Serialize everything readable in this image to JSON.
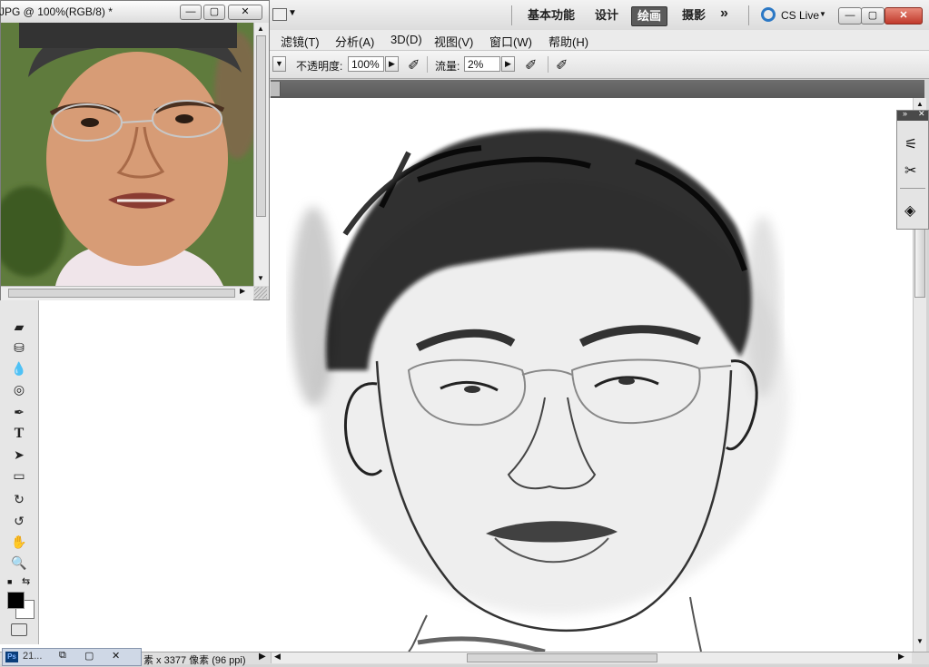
{
  "app": {
    "workspaces": [
      "基本功能",
      "设计",
      "绘画",
      "摄影"
    ],
    "active_workspace": "绘画",
    "more_label": "»",
    "cs_live": "CS Live",
    "win_min": "—",
    "win_max": "▢",
    "win_close": "✕"
  },
  "menus": [
    "滤镜(T)",
    "分析(A)",
    "3D(D)",
    "视图(V)",
    "窗口(W)",
    "帮助(H)"
  ],
  "options": {
    "opacity_label": "不透明度:",
    "opacity_value": "100%",
    "flow_label": "流量:",
    "flow_value": "2%"
  },
  "photo_window": {
    "title": "JPG @ 100%(RGB/8) *",
    "min": "—",
    "max": "▢",
    "close": "✕"
  },
  "status": {
    "doc_info": "素 x 3377 像素 (96 ppi)",
    "taskbar_item": "21..."
  },
  "tools": [
    "eraser-icon",
    "paint-bucket-icon",
    "blur-drop-icon",
    "sponge-icon",
    "pen-icon",
    "type-icon",
    "path-select-icon",
    "rectangle-shape-icon",
    "3d-rotate-icon",
    "3d-orbit-icon",
    "hand-icon",
    "zoom-icon"
  ],
  "tool_glyphs": [
    "▰",
    "⛁",
    "💧",
    "◎",
    "✒",
    "T",
    "➤",
    "▭",
    "↻",
    "↺",
    "✋",
    "🔍"
  ],
  "colors": {
    "foreground": "#000000",
    "background": "#ffffff",
    "accent": "#5b5b5b"
  }
}
